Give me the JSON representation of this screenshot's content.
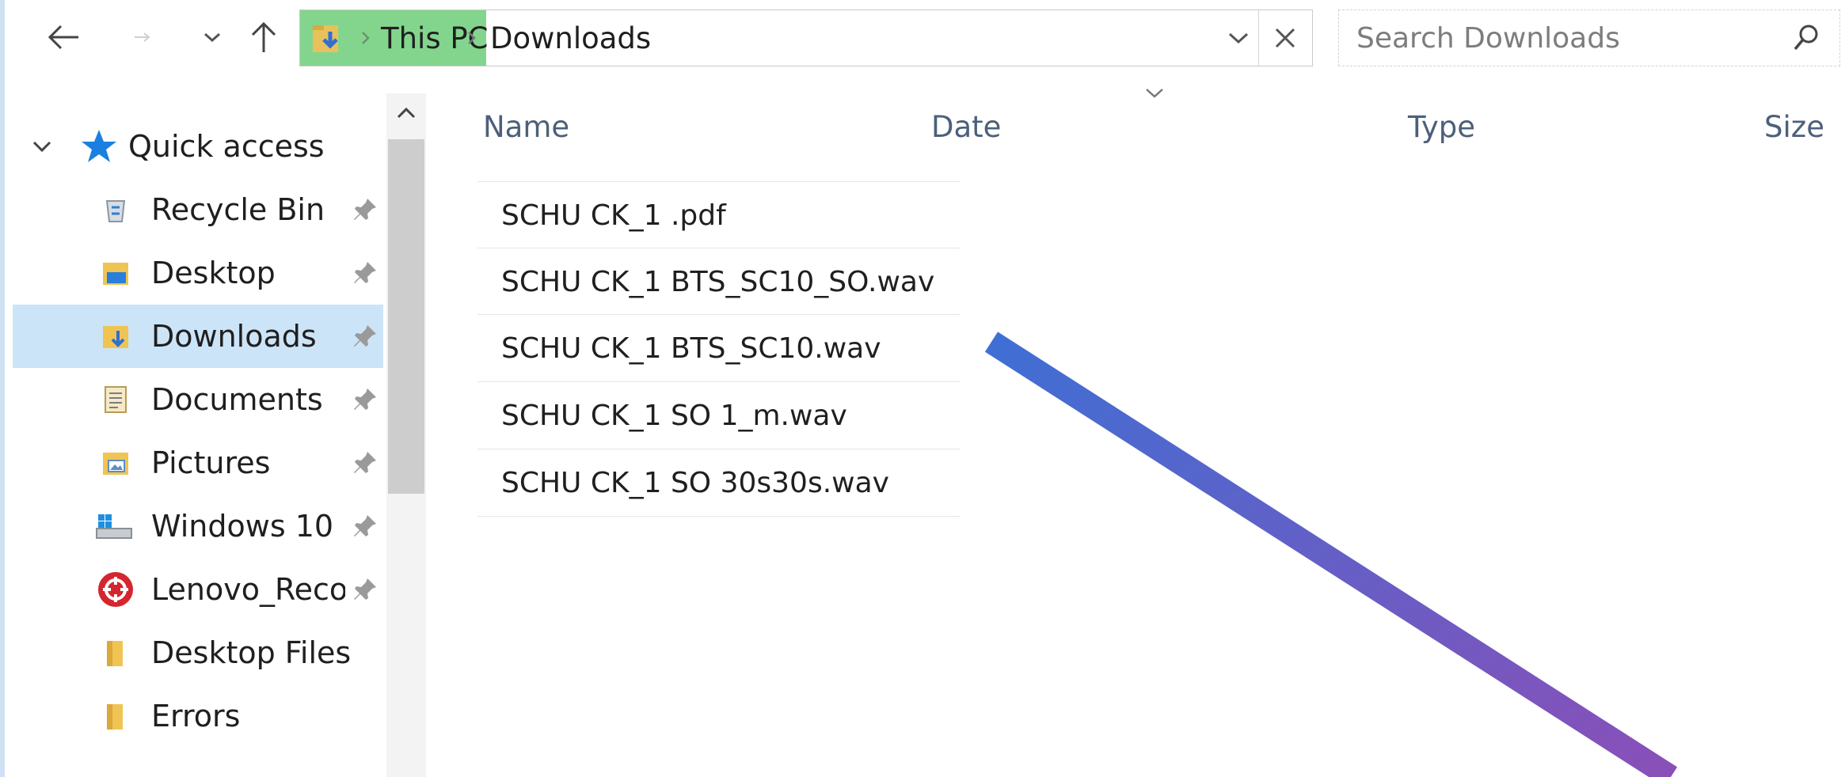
{
  "toolbar": {
    "back_icon": "back-arrow-icon",
    "forward_icon": "forward-arrow-icon",
    "recent_icon": "chevron-down-icon",
    "up_icon": "up-arrow-icon"
  },
  "address": {
    "crumbs": [
      "This PC",
      "Downloads"
    ],
    "dropdown_icon": "chevron-down-icon",
    "clear_icon": "close-icon",
    "highlight_color": "#83d58d"
  },
  "search": {
    "placeholder": "Search Downloads",
    "icon": "search-icon"
  },
  "nav": {
    "section_label": "Quick access",
    "items": [
      {
        "label": "Recycle Bin",
        "icon": "recycle-bin-icon",
        "pinned": true
      },
      {
        "label": "Desktop",
        "icon": "desktop-folder-icon",
        "pinned": true
      },
      {
        "label": "Downloads",
        "icon": "downloads-folder-icon",
        "pinned": true,
        "selected": true
      },
      {
        "label": "Documents",
        "icon": "documents-icon",
        "pinned": true
      },
      {
        "label": "Pictures",
        "icon": "pictures-folder-icon",
        "pinned": true
      },
      {
        "label": "Windows 10 (",
        "icon": "drive-icon",
        "pinned": true
      },
      {
        "label": "Lenovo_Reco",
        "icon": "lenovo-recovery-icon",
        "pinned": true
      },
      {
        "label": "Desktop Files",
        "icon": "folder-icon",
        "pinned": false
      },
      {
        "label": "Errors",
        "icon": "folder-icon",
        "pinned": false
      }
    ]
  },
  "columns": {
    "name": "Name",
    "date": "Date",
    "type": "Type",
    "size": "Size"
  },
  "files": [
    {
      "name": "SCHU CK_1 .pdf"
    },
    {
      "name": "SCHU CK_1 BTS_SC10_SO.wav"
    },
    {
      "name": "SCHU CK_1 BTS_SC10.wav"
    },
    {
      "name": "SCHU CK_1 SO 1_m.wav"
    },
    {
      "name": "SCHU CK_1 SO 30s30s.wav"
    }
  ],
  "colors": {
    "selection": "#cce4f7",
    "accent": "#0078d7",
    "arrow_start": "#3f6fd4",
    "arrow_end": "#8a4fb8"
  }
}
